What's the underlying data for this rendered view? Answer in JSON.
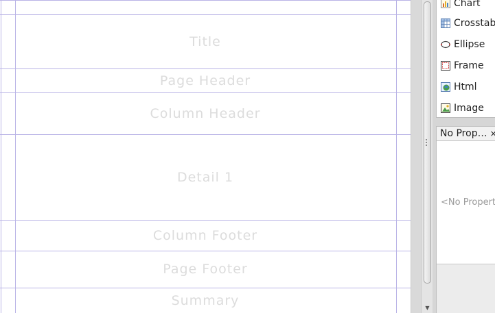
{
  "bands": [
    {
      "label": "Title"
    },
    {
      "label": "Page Header"
    },
    {
      "label": "Column Header"
    },
    {
      "label": "Detail 1"
    },
    {
      "label": "Column Footer"
    },
    {
      "label": "Page Footer"
    },
    {
      "label": "Summary"
    }
  ],
  "palette": {
    "items": [
      {
        "label": "Chart",
        "icon": "chart-icon"
      },
      {
        "label": "Crosstab",
        "icon": "crosstab-icon"
      },
      {
        "label": "Ellipse",
        "icon": "ellipse-icon"
      },
      {
        "label": "Frame",
        "icon": "frame-icon"
      },
      {
        "label": "Html",
        "icon": "html-icon"
      },
      {
        "label": "Image",
        "icon": "image-icon"
      }
    ]
  },
  "properties": {
    "tab_label": "No Prop…",
    "close_glyph": "×",
    "empty_text": "<No Properties>"
  }
}
